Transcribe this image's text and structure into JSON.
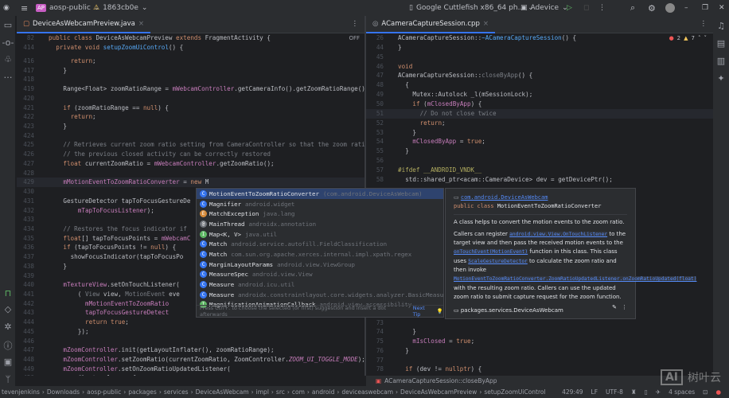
{
  "topbar": {
    "project_badge": "AP",
    "project": "aosp-public",
    "branch": "1863cb0e",
    "device": "Google Cuttlefish x86_64 ph...",
    "run_config": "Adevice"
  },
  "left_tab": "DeviceAsWebcamPreview.java",
  "left_off_label": "OFF",
  "right_tab": "ACameraCaptureSession.cpp",
  "right_errors": "2",
  "right_warnings": "7",
  "left_lines": [
    {
      "no": "82",
      "ind": 0,
      "seg": [
        [
          "kw",
          "public class "
        ],
        [
          "pl",
          "DeviceAsWebcamPreview "
        ],
        [
          "kw",
          "extends "
        ],
        [
          "pl",
          "FragmentActivity {"
        ]
      ]
    },
    {
      "no": "414",
      "ind": 1,
      "seg": [
        [
          "kw",
          "private void "
        ],
        [
          "fn",
          "setupZoomUiControl"
        ],
        [
          "pl",
          "() {"
        ]
      ]
    },
    {
      "no": "416",
      "ind": 3,
      "seg": [
        [
          "kw",
          "return"
        ],
        [
          "pl",
          ";"
        ]
      ]
    },
    {
      "no": "417",
      "ind": 2,
      "seg": [
        [
          "pl",
          "}"
        ]
      ]
    },
    {
      "no": "418",
      "ind": 2,
      "seg": []
    },
    {
      "no": "419",
      "ind": 2,
      "seg": [
        [
          "pl",
          "Range<Float> zoomRatioRange = "
        ],
        [
          "fd",
          "mWebcamController"
        ],
        [
          "pl",
          ".getCameraInfo().getZoomRatioRange();"
        ]
      ]
    },
    {
      "no": "420",
      "ind": 2,
      "seg": []
    },
    {
      "no": "421",
      "ind": 2,
      "seg": [
        [
          "kw",
          "if "
        ],
        [
          "pl",
          "(zoomRatioRange == "
        ],
        [
          "kw",
          "null"
        ],
        [
          "pl",
          ") {"
        ]
      ]
    },
    {
      "no": "422",
      "ind": 3,
      "seg": [
        [
          "kw",
          "return"
        ],
        [
          "pl",
          ";"
        ]
      ]
    },
    {
      "no": "423",
      "ind": 2,
      "seg": [
        [
          "pl",
          "}"
        ]
      ]
    },
    {
      "no": "424",
      "ind": 2,
      "seg": []
    },
    {
      "no": "425",
      "ind": 2,
      "seg": [
        [
          "cm",
          "// Retrieves current zoom ratio setting from CameraController so that the zoom ratio s"
        ]
      ]
    },
    {
      "no": "426",
      "ind": 2,
      "seg": [
        [
          "cm",
          "// the previous closed activity can be correctly restored"
        ]
      ]
    },
    {
      "no": "427",
      "ind": 2,
      "seg": [
        [
          "kw",
          "float "
        ],
        [
          "pl",
          "currentZoomRatio = "
        ],
        [
          "fd",
          "mWebcamController"
        ],
        [
          "pl",
          ".getZoomRatio();"
        ]
      ]
    },
    {
      "no": "428",
      "ind": 2,
      "seg": []
    },
    {
      "no": "429",
      "ind": 2,
      "seg": [
        [
          "fd",
          "mMotionEventToZoomRatioConverter"
        ],
        [
          "pl",
          " = "
        ],
        [
          "kw",
          "new "
        ],
        [
          "pl",
          "M"
        ]
      ]
    },
    {
      "no": "430",
      "ind": 2,
      "seg": []
    },
    {
      "no": "431",
      "ind": 2,
      "seg": [
        [
          "pl",
          "GestureDetector tapToFocusGestureDe"
        ]
      ]
    },
    {
      "no": "432",
      "ind": 4,
      "seg": [
        [
          "fd",
          "mTapToFocusListener"
        ],
        [
          "pl",
          ");"
        ]
      ]
    },
    {
      "no": "433",
      "ind": 2,
      "seg": []
    },
    {
      "no": "434",
      "ind": 2,
      "seg": [
        [
          "cm",
          "// Restores the focus indicator if"
        ]
      ]
    },
    {
      "no": "435",
      "ind": 2,
      "seg": [
        [
          "kw",
          "float"
        ],
        [
          "pl",
          "[] tapToFocusPoints = "
        ],
        [
          "fd",
          "mWebcamC"
        ]
      ]
    },
    {
      "no": "436",
      "ind": 2,
      "seg": [
        [
          "kw",
          "if "
        ],
        [
          "pl",
          "(tapToFocusPoints != "
        ],
        [
          "kw",
          "null"
        ],
        [
          "pl",
          ") {"
        ]
      ]
    },
    {
      "no": "437",
      "ind": 3,
      "seg": [
        [
          "pl",
          "showFocusIndicator(tapToFocusPo"
        ]
      ]
    },
    {
      "no": "438",
      "ind": 2,
      "seg": [
        [
          "pl",
          "}"
        ]
      ]
    },
    {
      "no": "439",
      "ind": 2,
      "seg": []
    },
    {
      "no": "440",
      "ind": 2,
      "seg": [
        [
          "fd",
          "mTextureView"
        ],
        [
          "pl",
          ".setOnTouchListener("
        ]
      ]
    },
    {
      "no": "441",
      "ind": 4,
      "seg": [
        [
          "pl",
          "( "
        ],
        [
          "cm",
          "View "
        ],
        [
          "pl",
          "view, "
        ],
        [
          "cm",
          "MotionEvent "
        ],
        [
          "pl",
          "eve"
        ]
      ]
    },
    {
      "no": "442",
      "ind": 5,
      "seg": [
        [
          "fd",
          "mMotionEventToZoomRatio"
        ]
      ]
    },
    {
      "no": "443",
      "ind": 5,
      "seg": [
        [
          "fd",
          "tapToFocusGestureDetect"
        ]
      ]
    },
    {
      "no": "444",
      "ind": 5,
      "seg": [
        [
          "kw",
          "return true"
        ],
        [
          "pl",
          ";"
        ]
      ]
    },
    {
      "no": "445",
      "ind": 4,
      "seg": [
        [
          "pl",
          "});"
        ]
      ]
    },
    {
      "no": "446",
      "ind": 2,
      "seg": []
    },
    {
      "no": "447",
      "ind": 2,
      "seg": [
        [
          "fd",
          "mZoomController"
        ],
        [
          "pl",
          ".init(getLayoutInflater(), zoomRatioRange);"
        ]
      ]
    },
    {
      "no": "448",
      "ind": 2,
      "seg": [
        [
          "fd",
          "mZoomController"
        ],
        [
          "pl",
          ".setZoomRatio(currentZoomRatio, ZoomController."
        ],
        [
          "it2",
          "ZOOM_UI_TOGGLE_MODE"
        ],
        [
          "pl",
          ");"
        ]
      ]
    },
    {
      "no": "449",
      "ind": 2,
      "seg": [
        [
          "fd",
          "mZoomController"
        ],
        [
          "pl",
          ".setOnZoomRatioUpdatedListener("
        ]
      ]
    },
    {
      "no": "450",
      "ind": 4,
      "seg": [
        [
          "cm",
          "float "
        ],
        [
          "pl",
          "value -> {"
        ]
      ]
    }
  ],
  "right_lines": [
    {
      "no": "26",
      "ind": 0,
      "seg": [
        [
          "pl",
          "ACameraCaptureSession::"
        ],
        [
          "fn",
          "~ACameraCaptureSession"
        ],
        [
          "pl",
          "() {"
        ]
      ]
    },
    {
      "no": "44",
      "ind": 0,
      "seg": [
        [
          "pl",
          "}"
        ]
      ]
    },
    {
      "no": "45",
      "ind": 0,
      "seg": []
    },
    {
      "no": "46",
      "ind": 0,
      "seg": [
        [
          "kw",
          "void"
        ]
      ]
    },
    {
      "no": "47",
      "ind": 0,
      "seg": [
        [
          "pl",
          "ACameraCaptureSession::"
        ],
        [
          "cm",
          "closeByApp"
        ],
        [
          "pl",
          "() {"
        ]
      ]
    },
    {
      "no": "48",
      "ind": 1,
      "seg": [
        [
          "pl",
          "{"
        ]
      ]
    },
    {
      "no": "49",
      "ind": 2,
      "seg": [
        [
          "pl",
          "Mutex::Autolock _l(mSessionLock);"
        ]
      ]
    },
    {
      "no": "50",
      "ind": 2,
      "seg": [
        [
          "kw",
          "if "
        ],
        [
          "pl",
          "("
        ],
        [
          "fd",
          "mClosedByApp"
        ],
        [
          "pl",
          ") {"
        ]
      ]
    },
    {
      "no": "51",
      "ind": 3,
      "seg": [
        [
          "cm",
          "// Do not close twice"
        ]
      ]
    },
    {
      "no": "52",
      "ind": 3,
      "seg": [
        [
          "kw",
          "return"
        ],
        [
          "pl",
          ";"
        ]
      ]
    },
    {
      "no": "53",
      "ind": 2,
      "seg": [
        [
          "pl",
          "}"
        ]
      ]
    },
    {
      "no": "54",
      "ind": 2,
      "seg": [
        [
          "fd",
          "mClosedByApp"
        ],
        [
          "pl",
          " = "
        ],
        [
          "kw",
          "true"
        ],
        [
          "pl",
          ";"
        ]
      ]
    },
    {
      "no": "55",
      "ind": 1,
      "seg": [
        [
          "pl",
          "}"
        ]
      ]
    },
    {
      "no": "56",
      "ind": 0,
      "seg": []
    },
    {
      "no": "57",
      "ind": 0,
      "seg": [
        [
          "mc",
          "#ifdef __ANDROID_VNDK__"
        ]
      ]
    },
    {
      "no": "58",
      "ind": 1,
      "seg": [
        [
          "pl",
          "std::shared_ptr<acam::CameraDevice> dev = getDevicePtr();"
        ]
      ]
    },
    {
      "no": "72",
      "ind": 0,
      "seg": [
        [
          "pl",
          "                                      "
        ],
        [
          "st",
          "ion %p\""
        ],
        [
          "pl",
          ", "
        ],
        [
          "kw",
          "this"
        ],
        [
          "pl",
          ");"
        ]
      ]
    },
    {
      "no": "73",
      "ind": 3,
      "seg": []
    },
    {
      "no": "74",
      "ind": 2,
      "seg": [
        [
          "pl",
          "}"
        ]
      ]
    },
    {
      "no": "75",
      "ind": 2,
      "seg": [
        [
          "fd",
          "mIsClosed"
        ],
        [
          "pl",
          " = "
        ],
        [
          "kw",
          "true"
        ],
        [
          "pl",
          ";"
        ]
      ]
    },
    {
      "no": "76",
      "ind": 1,
      "seg": [
        [
          "pl",
          "}"
        ]
      ]
    },
    {
      "no": "77",
      "ind": 0,
      "seg": []
    },
    {
      "no": "78",
      "ind": 1,
      "seg": [
        [
          "kw",
          "if "
        ],
        [
          "pl",
          "(dev != "
        ],
        [
          "kw",
          "nullptr"
        ],
        [
          "pl",
          ") {"
        ]
      ]
    }
  ],
  "completion": {
    "items": [
      {
        "name": "MotionEventToZoomRatioConverter",
        "pkg": "(com.android.DeviceAsWebcam)",
        "icon": "C"
      },
      {
        "name": "Magnifier",
        "pkg": "android.widget",
        "icon": "C"
      },
      {
        "name": "MatchException",
        "pkg": "java.lang",
        "icon": "E"
      },
      {
        "name": "MainThread",
        "pkg": "androidx.annotation",
        "icon": "@"
      },
      {
        "name": "Map<K, V>",
        "pkg": "java.util",
        "icon": "I"
      },
      {
        "name": "Match",
        "pkg": "android.service.autofill.FieldClassification",
        "icon": "C"
      },
      {
        "name": "Match",
        "pkg": "com.sun.org.apache.xerces.internal.impl.xpath.regex",
        "icon": "C"
      },
      {
        "name": "MarginLayoutParams",
        "pkg": "android.view.ViewGroup",
        "icon": "C"
      },
      {
        "name": "MeasureSpec",
        "pkg": "android.view.View",
        "icon": "C"
      },
      {
        "name": "Measure",
        "pkg": "android.icu.util",
        "icon": "C"
      },
      {
        "name": "Measure",
        "pkg": "androidx.constraintlayout.core.widgets.analyzer.BasicMeasu...",
        "icon": "C"
      },
      {
        "name": "MagnificationAnimationCallback",
        "pkg": "android.view.accessibility",
        "icon": "I"
      }
    ],
    "hint": "Press Ctrl+. to choose the selected (or first) suggestion and insert a dot afterwards",
    "next_tip": "Next Tip"
  },
  "doc": {
    "package": "com.android.DeviceAsWebcam",
    "signature_kw": "public class",
    "signature_name": "MotionEventToZoomRatioConverter",
    "summary": "A class helps to convert the motion events to the zoom ratio.",
    "p1": "Callers can register",
    "l1": "android.view.View.OnTouchListener",
    "p2": "to the target view and then pass the received motion events to the",
    "l2": "onTouchEvent(MotionEvent)",
    "p3": "function in this class. This class uses",
    "l3": "ScaleGestureDetector",
    "p4": "to calculate the zoom ratio and then invoke",
    "l4": "MotionEventToZoomRatioConverter.ZoomRatioUpdatedListener.onZoomRatioUpdated(float)",
    "p5": "with the resulting zoom ratio. Callers can use the updated zoom ratio to submit capture request for the zoom function.",
    "module": "packages.services.DeviceAsWebcam"
  },
  "right_breadcrumb": "ACameraCaptureSession::closeByApp",
  "status": {
    "crumbs": [
      "tevenjenkins",
      "Downloads",
      "aosp-public",
      "packages",
      "services",
      "DeviceAsWebcam",
      "impl",
      "src",
      "com",
      "android",
      "deviceaswebcam",
      "DeviceAsWebcamPreview",
      "setupZoomUiControl"
    ],
    "position": "429:49",
    "line_sep": "LF",
    "encoding": "UTF-8",
    "indent": "4 spaces"
  },
  "watermark": "树叶云"
}
